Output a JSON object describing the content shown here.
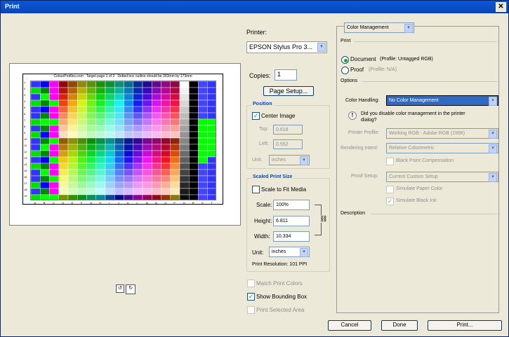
{
  "title": "Print",
  "preview": {
    "top_line": [
      "ColourProfiles.com",
      "Target page 1 of 3",
      "Dotted box outline should be 263mm by 173mm"
    ],
    "row_labels": [
      "1",
      "2",
      "3",
      "4",
      "5",
      "6",
      "7",
      "8",
      "9",
      "10",
      "11",
      "12",
      "13",
      "14",
      "15",
      "16",
      "17",
      "18",
      "19"
    ],
    "col_labels": [
      "A",
      "B",
      "C",
      "D",
      "E",
      "F",
      "G",
      "H",
      "I",
      "J",
      "K",
      "L",
      "M",
      "N",
      "O",
      "P",
      "Q",
      "R",
      "S",
      "T"
    ]
  },
  "printer": {
    "label": "Printer:",
    "value": "EPSON Stylus Pro 3..."
  },
  "copies": {
    "label": "Copies:",
    "value": "1"
  },
  "page_setup": "Page Setup...",
  "position": {
    "title": "Position",
    "center_image": "Center Image",
    "top_label": "Top:",
    "top_value": "0.618",
    "left_label": "Left:",
    "left_value": "0.552",
    "unit_label": "Unit:",
    "unit_value": "inches"
  },
  "scaled": {
    "title": "Scaled Print Size",
    "scale_to_fit": "Scale to Fit Media",
    "scale_label": "Scale:",
    "scale_value": "100%",
    "height_label": "Height:",
    "height_value": "6.811",
    "width_label": "Width:",
    "width_value": "10.334",
    "unit_label": "Unit:",
    "unit_value": "inches",
    "resolution": "Print Resolution: 101 PPI"
  },
  "bottom_checks": {
    "match": "Match Print Colors",
    "bounding": "Show Bounding Box",
    "selected": "Print Selected Area"
  },
  "right": {
    "mode": "Color Management",
    "print_label": "Print",
    "document": "Document",
    "document_profile": "(Profile: Untagged RGB)",
    "proof": "Proof",
    "proof_profile": "(Profile: N/A)",
    "options_label": "Options",
    "color_handling_label": "Color Handling:",
    "color_handling_value": "No Color Management",
    "warning": "Did you disable color management in the printer dialog?",
    "printer_profile_label": "Printer Profile:",
    "printer_profile_value": "Working RGB - Adobe RGB (1998)",
    "rendering_label": "Rendering Intent:",
    "rendering_value": "Relative Colorimetric",
    "black_point": "Black Point Compensation",
    "proof_setup_label": "Proof Setup:",
    "proof_setup_value": "Current Custom Setup",
    "sim_paper": "Simulate Paper Color",
    "sim_black": "Simulate Black Ink",
    "description_label": "Description"
  },
  "buttons": {
    "cancel": "Cancel",
    "done": "Done",
    "print": "Print..."
  },
  "colors": {
    "title_bar": "#0846b8",
    "accent": "#0046d5",
    "selection": "#316ac5"
  }
}
